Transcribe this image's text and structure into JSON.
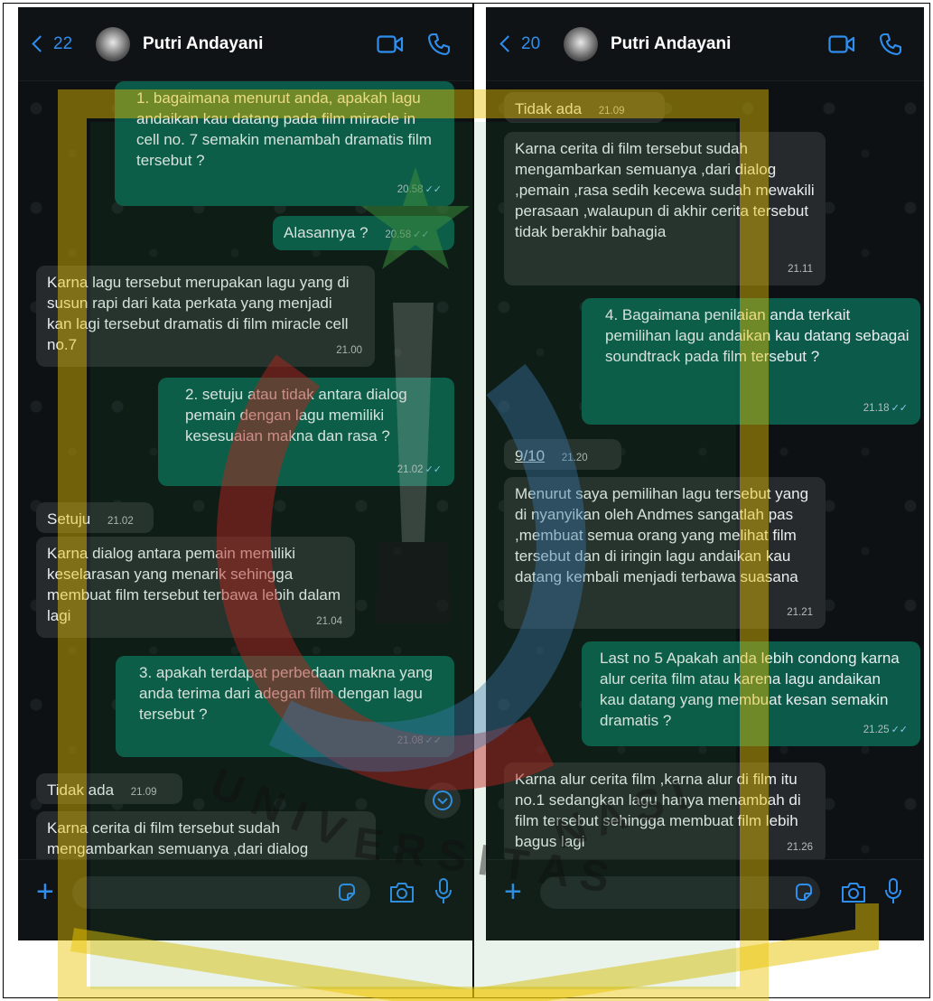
{
  "left": {
    "back_count": "22",
    "contact_name": "Putri Andayani",
    "messages": [
      {
        "text": "1. bagaimana menurut anda, apakah lagu andaikan kau datang pada film miracle in cell no. 7 semakin menambah dramatis film tersebut ?",
        "time": "20.58"
      },
      {
        "text": "Alasannya ?",
        "time": "20.58"
      },
      {
        "text": "Karna lagu tersebut merupakan lagu yang di susun rapi dari kata perkata yang menjadi kan lagi tersebut dramatis di film miracle cell no.7",
        "time": "21.00"
      },
      {
        "text": "2. setuju atau tidak antara dialog pemain dengan lagu memiliki kesesuaian makna dan rasa ?",
        "time": "21.02"
      },
      {
        "text": "Setuju",
        "time": "21.02"
      },
      {
        "text": "Karna dialog antara pemain memiliki keselarasan yang menarik sehingga membuat film tersebut terbawa lebih dalam lagi",
        "time": "21.04"
      },
      {
        "text": "3. apakah terdapat perbedaan makna yang anda terima dari adegan film dengan lagu tersebut ?",
        "time": "21.08"
      },
      {
        "text": "Tidak ada",
        "time": "21.09"
      },
      {
        "text": "Karna cerita di film tersebut sudah mengambarkan semuanya ,dari dialog ,pemain ,rasa sedih kecewa",
        "time": ""
      }
    ]
  },
  "right": {
    "back_count": "20",
    "contact_name": "Putri Andayani",
    "messages": [
      {
        "text": "Tidak ada",
        "time": "21.09"
      },
      {
        "text": "Karna cerita di film tersebut sudah mengambarkan semuanya ,dari dialog ,pemain ,rasa sedih kecewa sudah  mewakili perasaan ,walaupun di akhir cerita tersebut tidak berakhir bahagia",
        "time": "21.11"
      },
      {
        "text": "4. Bagaimana penilaian anda terkait pemilihan lagu andaikan kau datang sebagai soundtrack pada film tersebut ?",
        "time": "21.18"
      },
      {
        "text": "9/10",
        "time": "21.20"
      },
      {
        "text": "Menurut saya pemilihan lagu tersebut yang di nyanyikan oleh Andmes sangatlah pas ,membuat semua orang yang melihat film tersebut dan di iringin lagu andaikan kau datang kembali menjadi terbawa suasana",
        "time": "21.21"
      },
      {
        "text": "Last no 5 Apakah anda lebih condong karna alur cerita film atau karena lagu andaikan kau datang yang membuat kesan semakin dramatis ?",
        "time": "21.25"
      },
      {
        "text": "Karna alur cerita film ,karna alur di film itu no.1 sedangkan lagu hanya menambah di film tersebut sehingga membuat film lebih bagus lagi",
        "time": "21.26"
      }
    ]
  },
  "watermark": {
    "text": "UNIVERSITAS NASIONAL"
  },
  "colors": {
    "accent": "#2f8ff0",
    "outgoing": "#0b5a4a",
    "incoming": "#272a2c",
    "background": "#0d1113"
  }
}
